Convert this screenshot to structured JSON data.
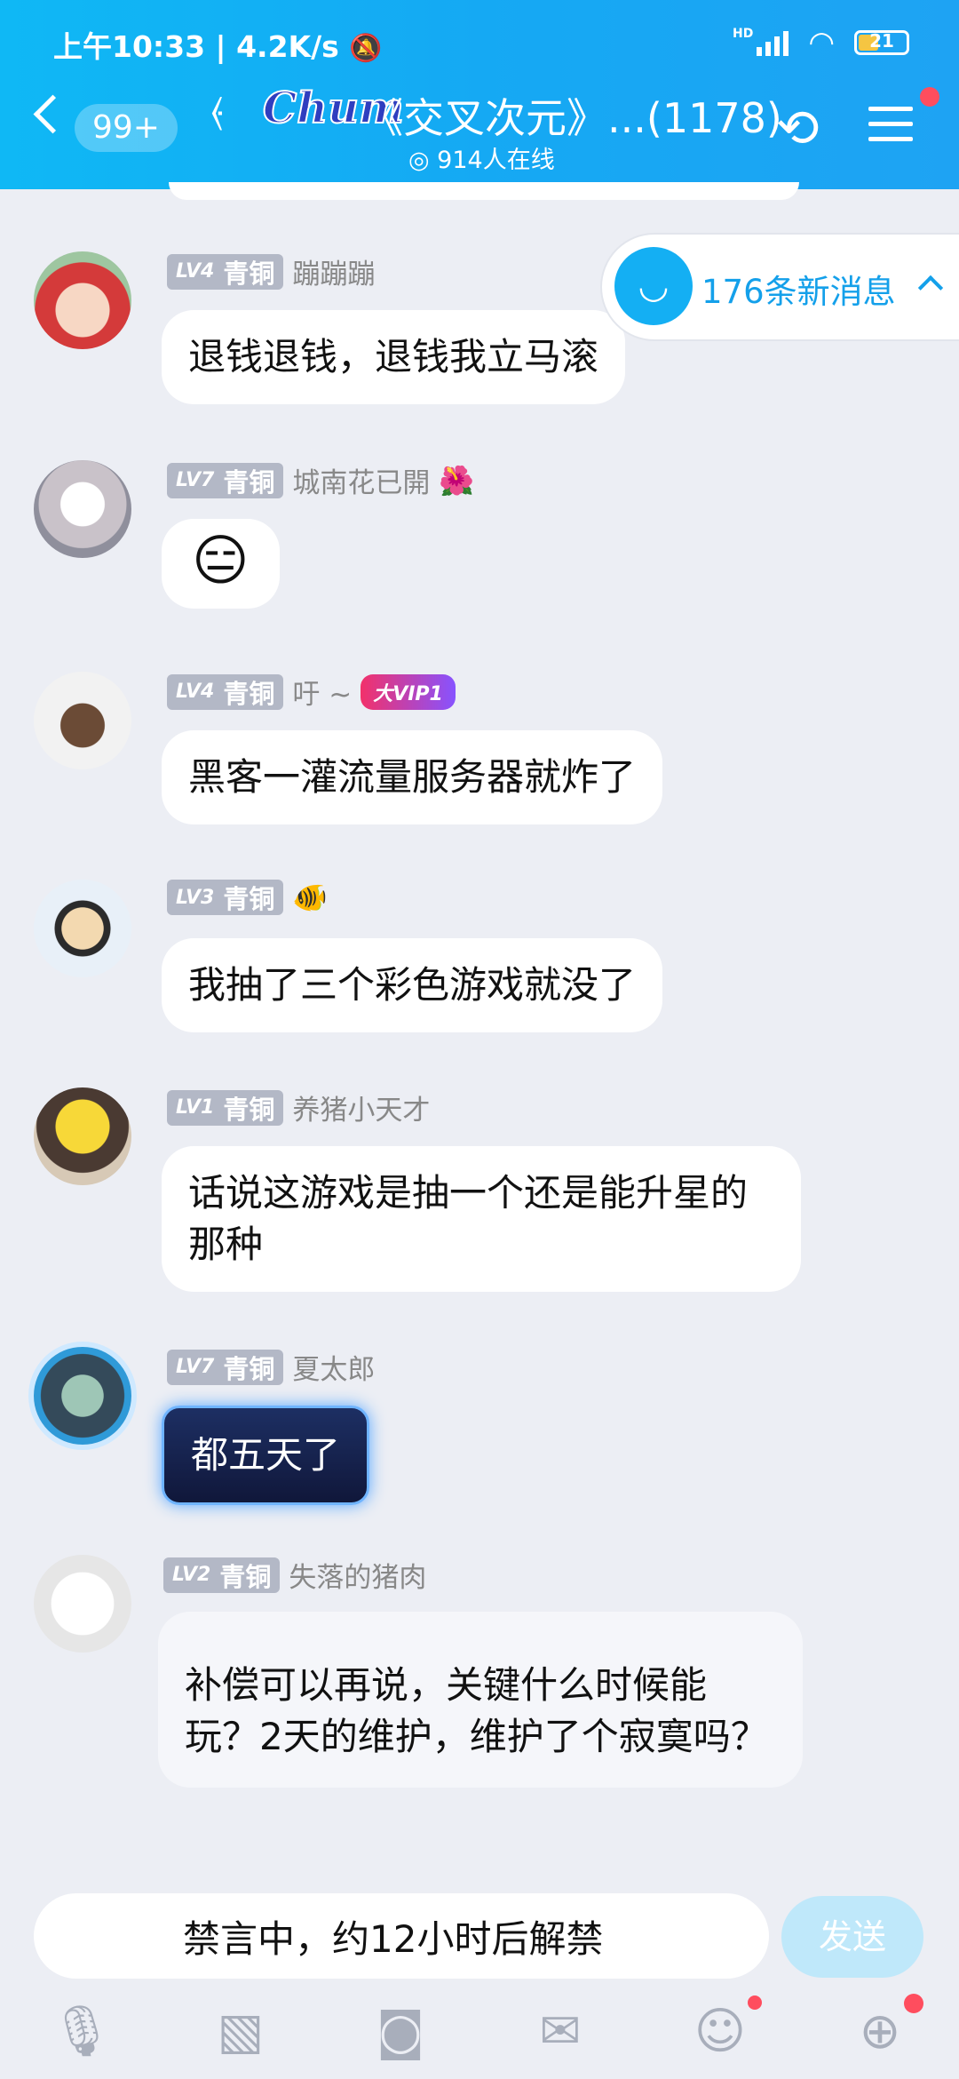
{
  "status": {
    "time": "上午10:33",
    "speed": "4.2K/s",
    "battery": "21",
    "network": "HD"
  },
  "header": {
    "unread": "99+",
    "logo": "Chum",
    "title": "《交叉次元》...(1178)",
    "online": "914人在线"
  },
  "new_messages": "176条新消息",
  "messages": [
    {
      "level": "LV4",
      "rank": "青铜",
      "name": "蹦蹦蹦",
      "text": "退钱退钱，退钱我立马滚"
    },
    {
      "level": "LV7",
      "rank": "青铜",
      "name": "城南花已開",
      "text": "😑"
    },
    {
      "level": "LV4",
      "rank": "青铜",
      "name": "吁 ~",
      "vip": "大VIP1",
      "text": "黑客一灌流量服务器就炸了"
    },
    {
      "level": "LV3",
      "rank": "青铜",
      "name": "",
      "text": "我抽了三个彩色游戏就没了"
    },
    {
      "level": "LV1",
      "rank": "青铜",
      "name": "养猪小天才",
      "text": "话说这游戏是抽一个还是能升星的那种"
    },
    {
      "level": "LV7",
      "rank": "青铜",
      "name": "夏太郎",
      "text": "都五天了"
    },
    {
      "level": "LV2",
      "rank": "青铜",
      "name": "失落的猪肉",
      "text": "补偿可以再说，关键什么时候能玩？2天的维护，维护了个寂寞吗？"
    }
  ],
  "input": {
    "muted_text": "禁言中，约12小时后解禁",
    "send": "发送"
  },
  "icons": [
    "microphone-icon",
    "image-icon",
    "camera-icon",
    "red-packet-icon",
    "emoji-icon",
    "plus-icon"
  ]
}
